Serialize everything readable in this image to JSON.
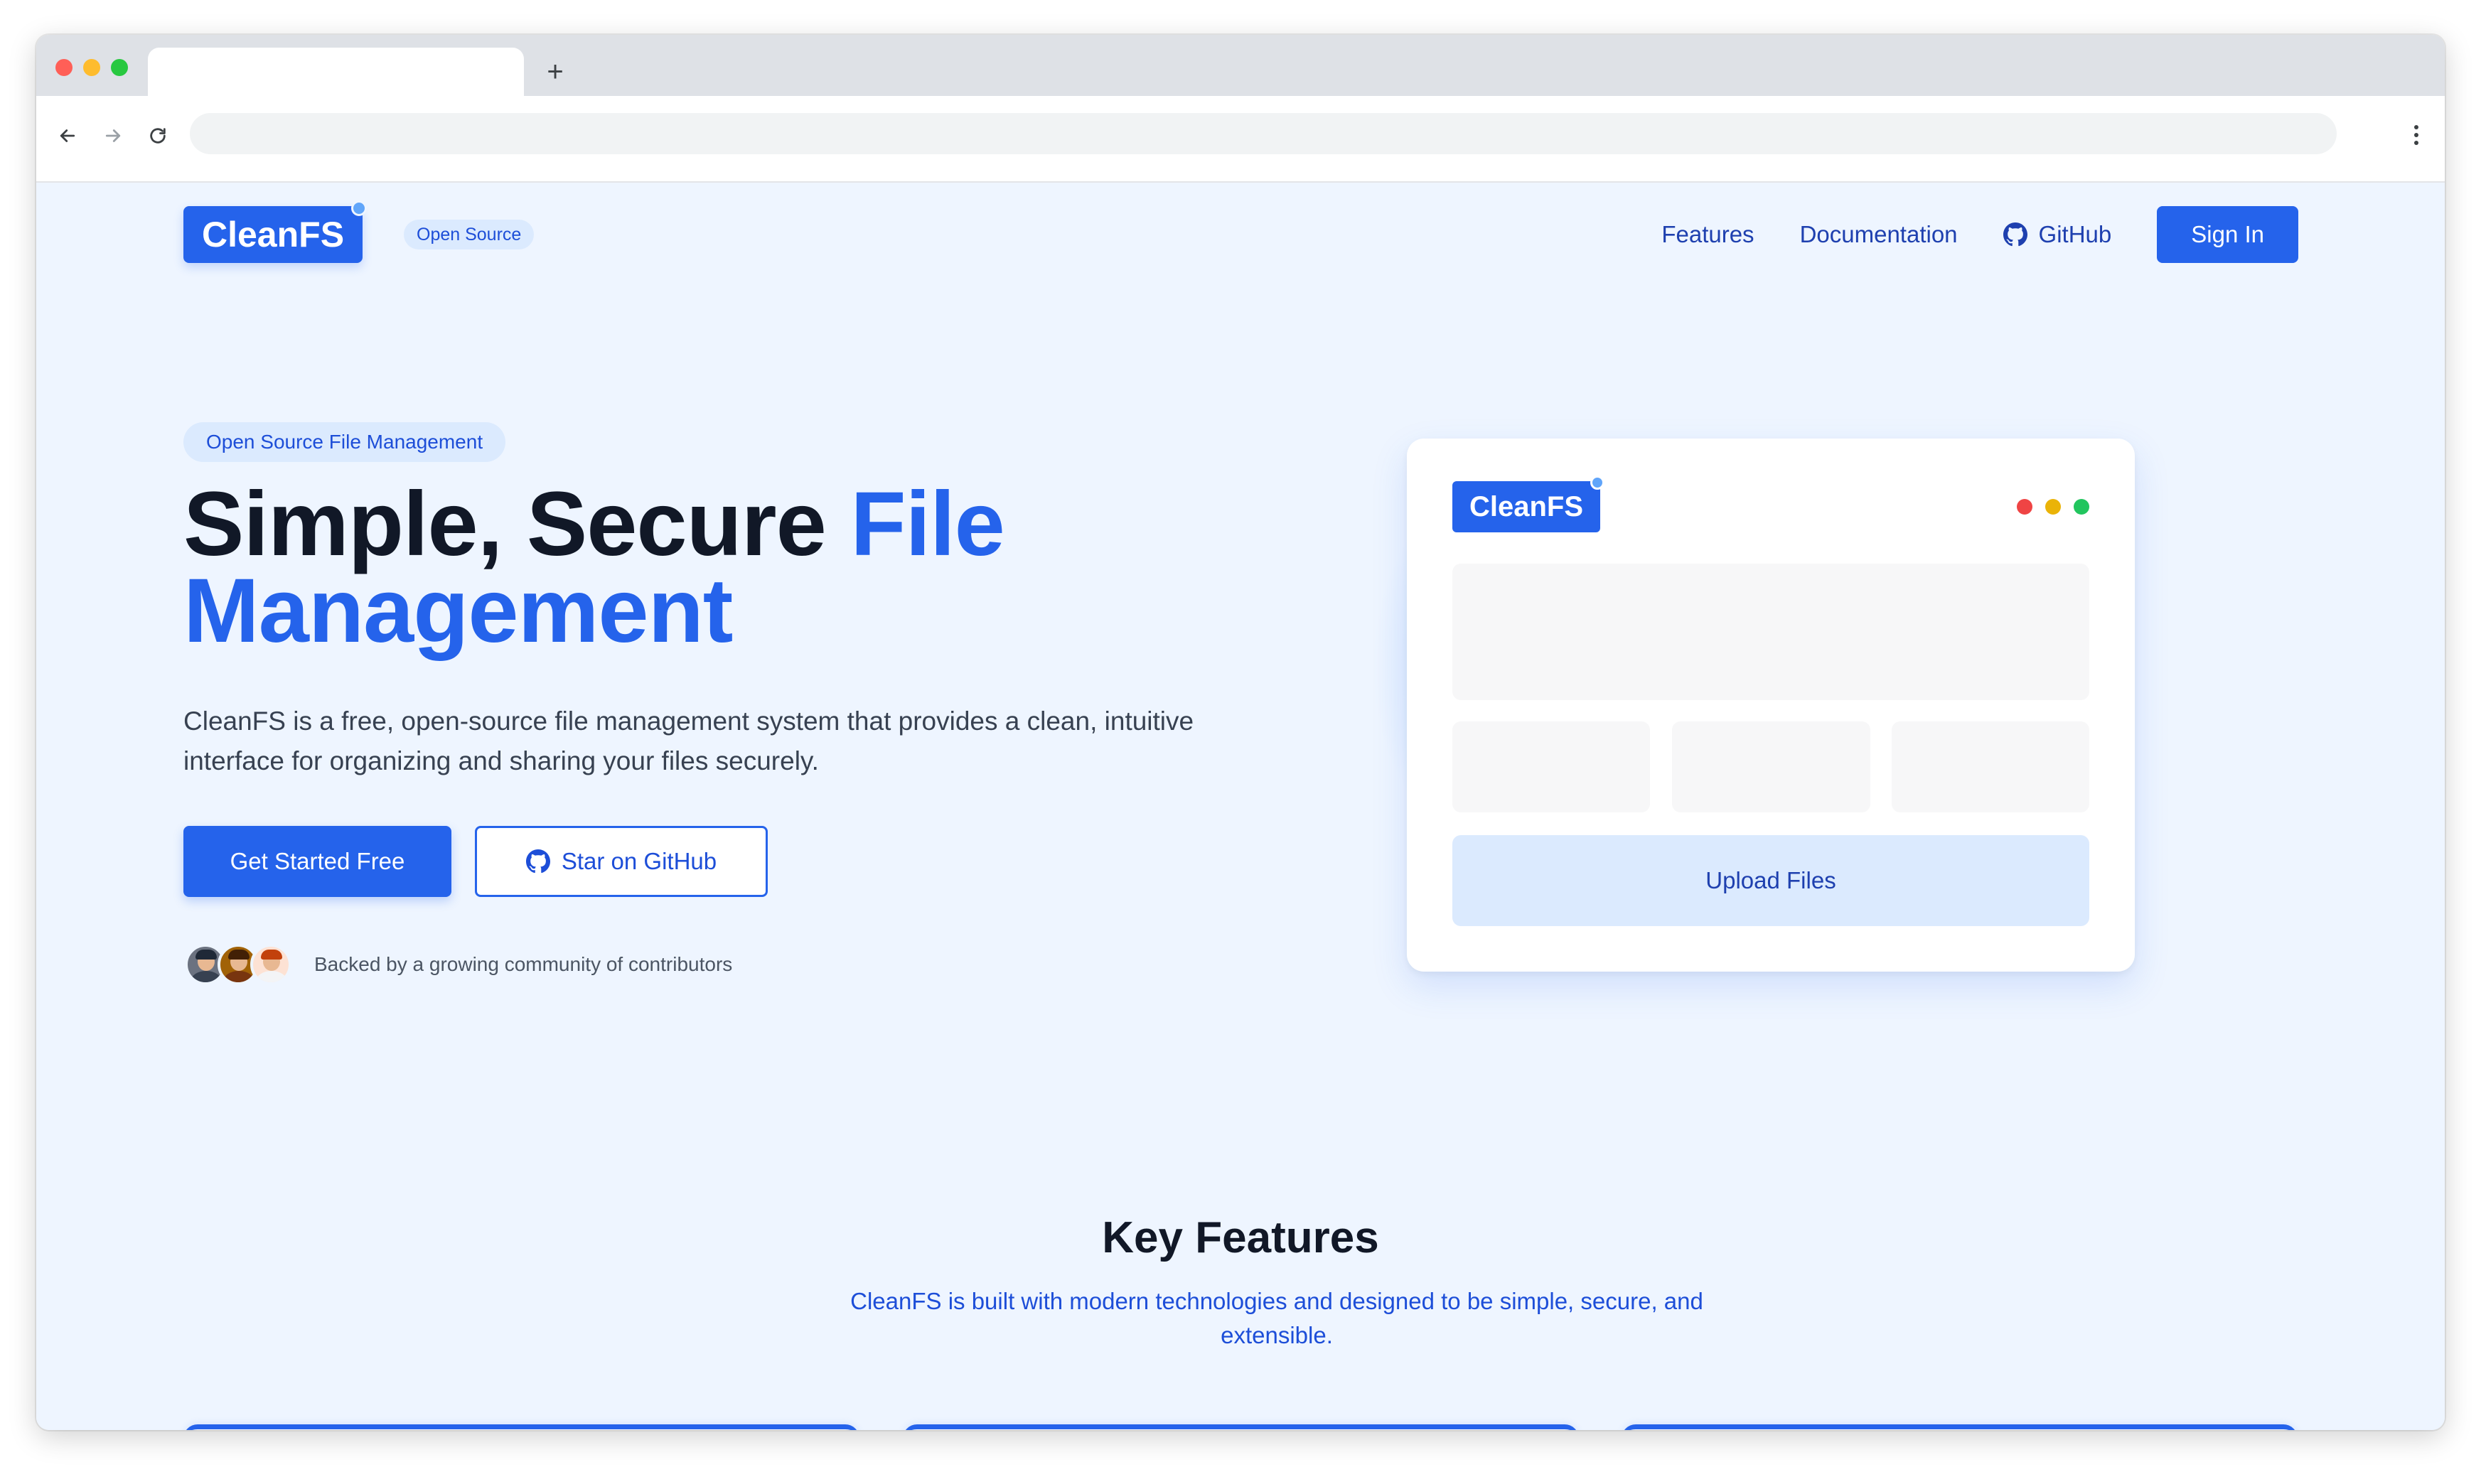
{
  "brand": {
    "name": "CleanFS",
    "badge": "Open Source",
    "primary_color": "#2563eb",
    "background_color": "#eef5ff"
  },
  "nav": {
    "items": [
      {
        "label": "Features"
      },
      {
        "label": "Documentation"
      },
      {
        "label": "GitHub",
        "icon": "github-icon"
      }
    ],
    "signin_label": "Sign In"
  },
  "hero": {
    "badge": "Open Source File Management",
    "title_part1": "Simple, Secure ",
    "title_accent": "File Management",
    "description": "CleanFS is a free, open-source file management system that provides a clean, intuitive interface for organizing and sharing your files securely.",
    "primary_button": "Get Started Free",
    "secondary_button": "Star on GitHub",
    "community_text": "Backed by a growing community of contributors"
  },
  "mockup": {
    "logo": "CleanFS",
    "upload_label": "Upload Files"
  },
  "features": {
    "title": "Key Features",
    "subtitle": "CleanFS is built with modern technologies and designed to be simple, secure, and extensible."
  }
}
